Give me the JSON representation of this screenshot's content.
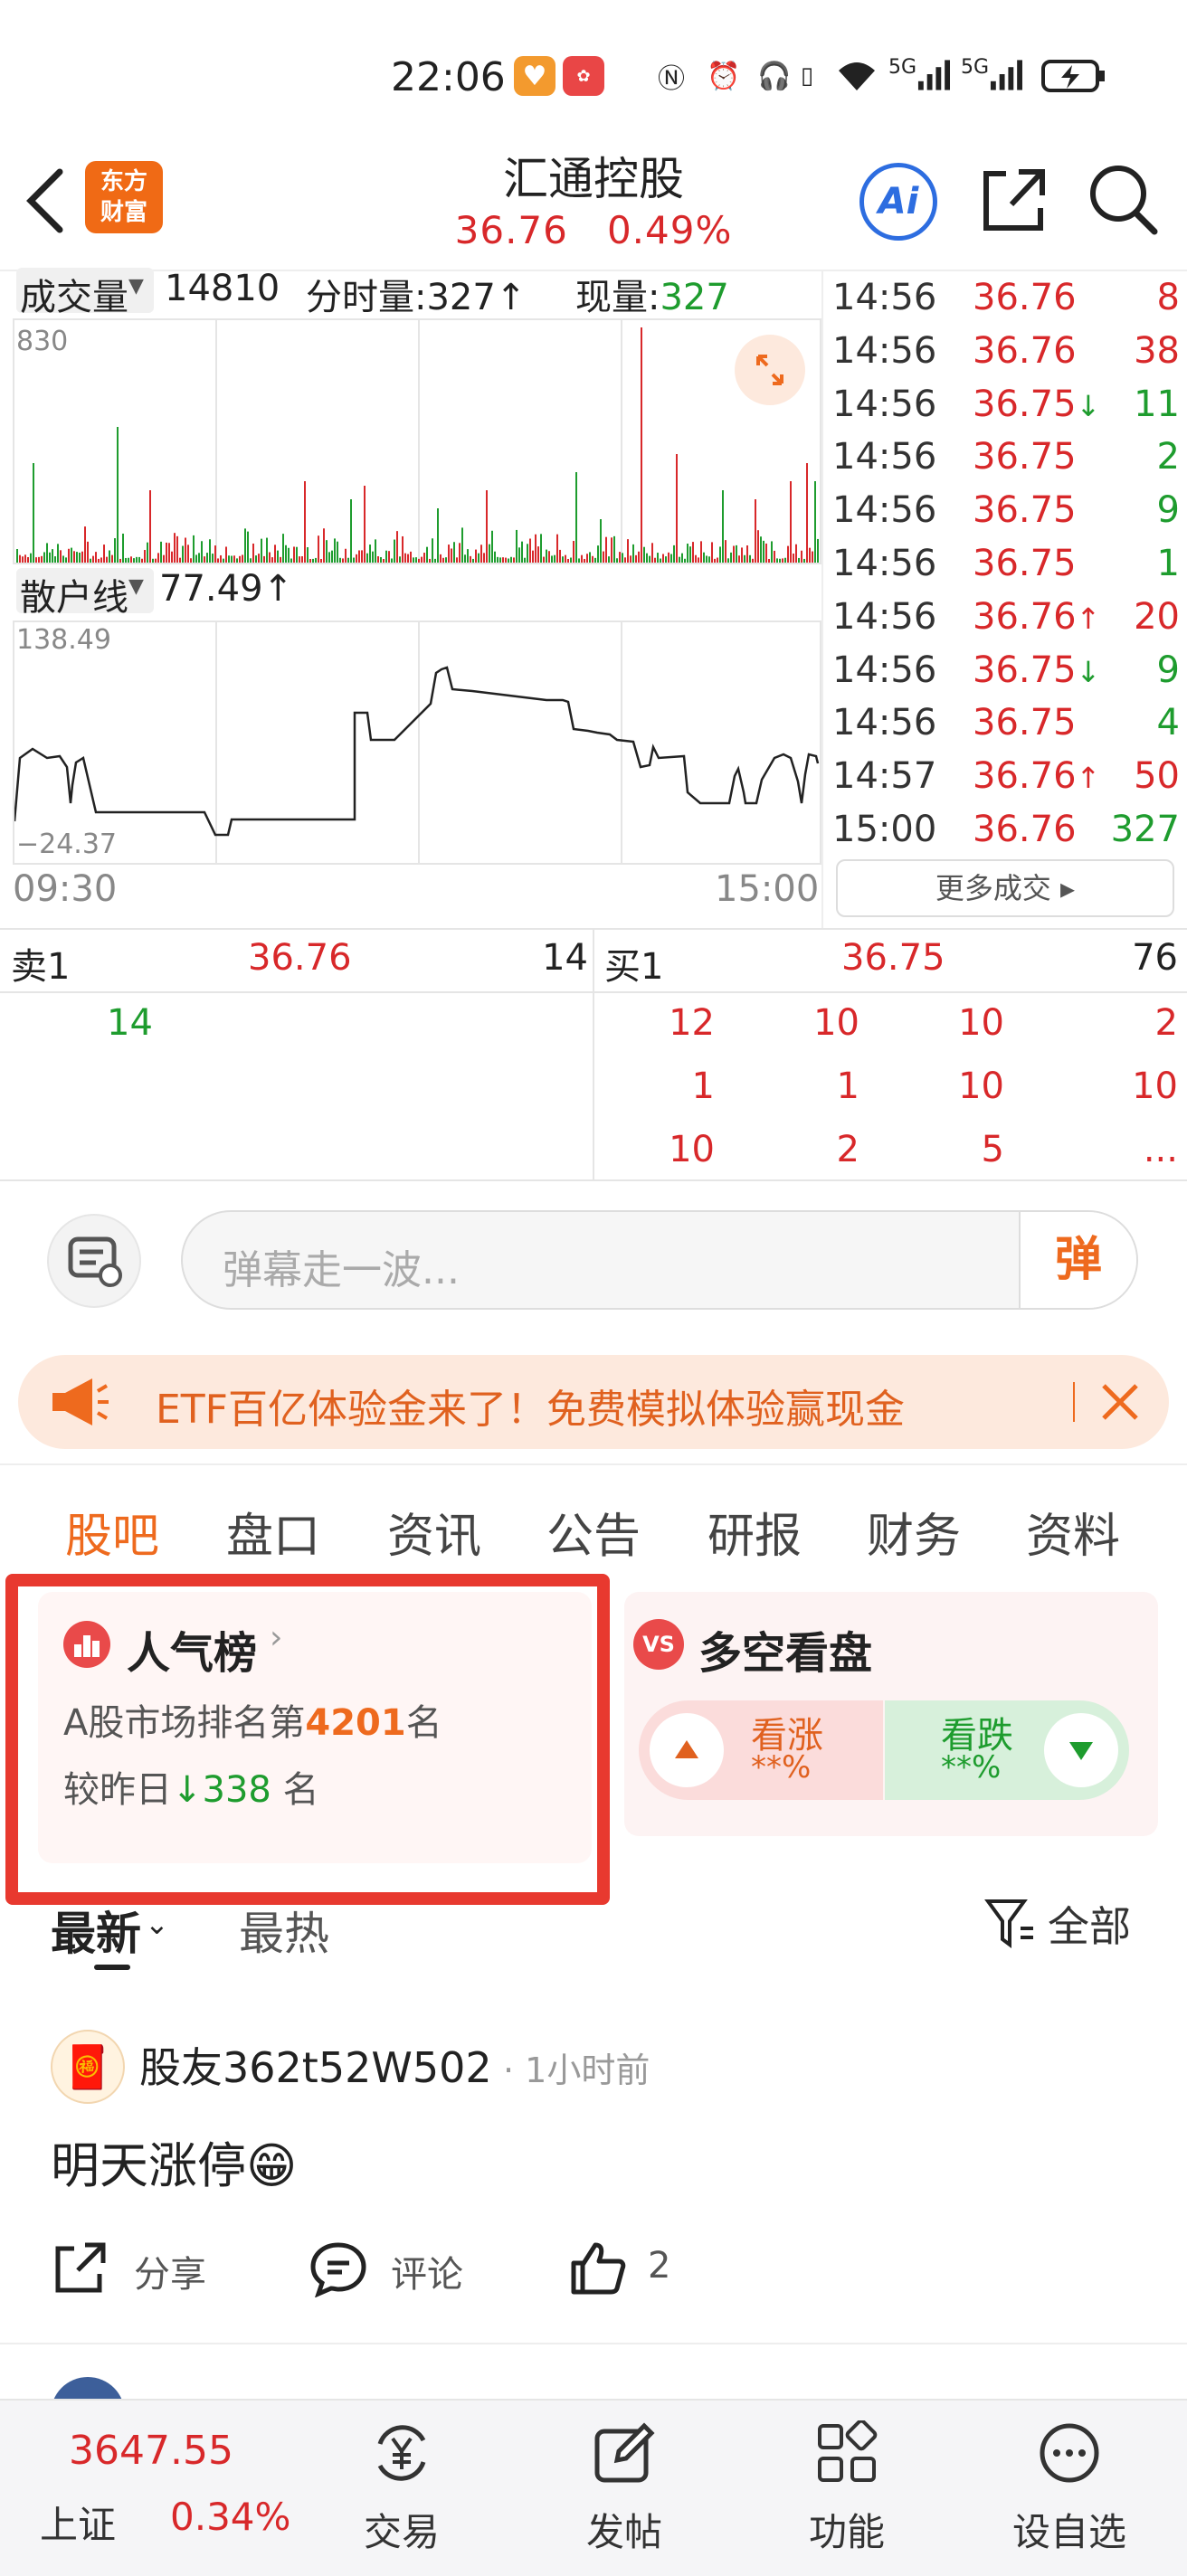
{
  "status_bar": {
    "time": "22:06",
    "signal1": "5G",
    "signal2": "5G"
  },
  "header": {
    "logo_line1": "东方",
    "logo_line2": "财富",
    "stock_name": "汇通控股",
    "price": "36.76",
    "change_pct": "0.49%",
    "ai_label": "Ai"
  },
  "volume_chart": {
    "label": "成交量",
    "volume": "14810",
    "tick_volume_label": "分时量:",
    "tick_volume_value": "327↑",
    "current_label": "现量:",
    "current_value": "327",
    "max_tick": "830"
  },
  "retail_chart": {
    "label": "散户线",
    "value": "77.49↑",
    "max_tick": "138.49",
    "min_tick": "−24.37",
    "time_start": "09:30",
    "time_end": "15:00"
  },
  "trades": [
    {
      "time": "14:56",
      "price": "36.76",
      "arrow": "",
      "volume": "8",
      "dir": "up"
    },
    {
      "time": "14:56",
      "price": "36.76",
      "arrow": "",
      "volume": "38",
      "dir": "up"
    },
    {
      "time": "14:56",
      "price": "36.75",
      "arrow": "↓",
      "volume": "11",
      "dir": "down"
    },
    {
      "time": "14:56",
      "price": "36.75",
      "arrow": "",
      "volume": "2",
      "dir": "down"
    },
    {
      "time": "14:56",
      "price": "36.75",
      "arrow": "",
      "volume": "9",
      "dir": "down"
    },
    {
      "time": "14:56",
      "price": "36.75",
      "arrow": "",
      "volume": "1",
      "dir": "down"
    },
    {
      "time": "14:56",
      "price": "36.76",
      "arrow": "↑",
      "volume": "20",
      "dir": "up"
    },
    {
      "time": "14:56",
      "price": "36.75",
      "arrow": "↓",
      "volume": "9",
      "dir": "down"
    },
    {
      "time": "14:56",
      "price": "36.75",
      "arrow": "",
      "volume": "4",
      "dir": "down"
    },
    {
      "time": "14:57",
      "price": "36.76",
      "arrow": "↑",
      "volume": "50",
      "dir": "up"
    },
    {
      "time": "15:00",
      "price": "36.76",
      "arrow": "",
      "volume": "327",
      "dir": "down"
    }
  ],
  "more_trades": "更多成交 ▸",
  "order_book": {
    "sell_label": "卖1",
    "sell_price": "36.76",
    "sell_volume": "14",
    "buy_label": "买1",
    "buy_price": "36.75",
    "buy_volume": "76",
    "sell_queue": [
      "14"
    ],
    "buy_queue": [
      [
        "12",
        "10",
        "10",
        "2"
      ],
      [
        "1",
        "1",
        "10",
        "10"
      ],
      [
        "10",
        "2",
        "5",
        "..."
      ]
    ]
  },
  "danmu": {
    "placeholder": "弹幕走一波...",
    "send": "弹"
  },
  "banner": {
    "text": "ETF百亿体验金来了！免费模拟体验赢现金"
  },
  "tabs": [
    "股吧",
    "盘口",
    "资讯",
    "公告",
    "研报",
    "财务",
    "资料"
  ],
  "popularity": {
    "title": "人气榜",
    "rank_prefix": "A股市场排名第",
    "rank": "4201",
    "rank_suffix": "名",
    "change_prefix": "较昨日",
    "change_value": "338",
    "change_suffix": "名"
  },
  "long_short": {
    "title": "多空看盘",
    "badge": "VS",
    "bull_label": "看涨",
    "bull_value": "**%",
    "bear_label": "看跌",
    "bear_value": "**%"
  },
  "feed": {
    "sort_latest": "最新",
    "sort_hot": "最热",
    "filter": "全部",
    "post": {
      "author": "股友362t52W502",
      "time": "· 1小时前",
      "content": "明天涨停😁",
      "share": "分享",
      "comment": "评论",
      "likes": "2"
    }
  },
  "bottom_nav": {
    "index_value": "3647.55",
    "index_name": "上证",
    "index_change": "0.34%",
    "items": [
      "交易",
      "发帖",
      "功能",
      "设自选"
    ]
  },
  "colors": {
    "up": "#d8282a",
    "down": "#1e9c2e",
    "accent": "#ee6a1e",
    "highlight": "#e8392f"
  }
}
